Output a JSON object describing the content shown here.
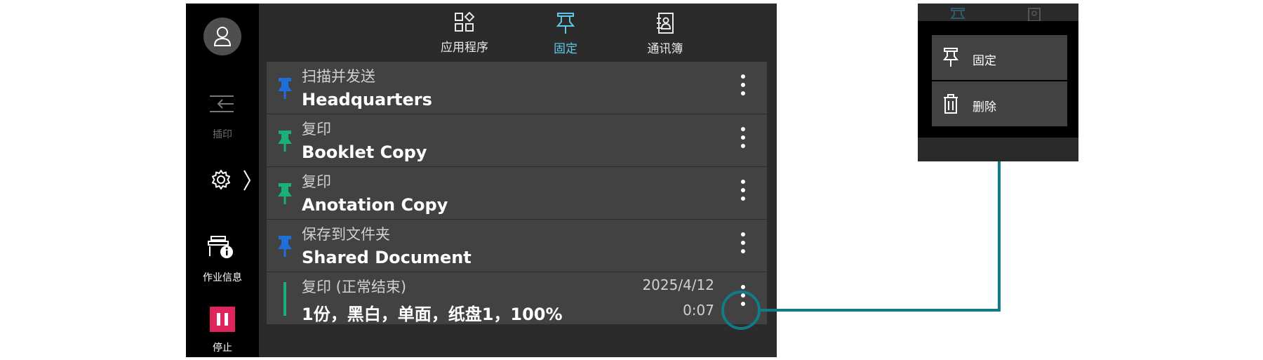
{
  "sidebar": {
    "insert_label": "插印",
    "job_info_label": "作业信息",
    "stop_label": "停止"
  },
  "tabs": [
    {
      "label": "应用程序",
      "icon": "apps-grid-icon"
    },
    {
      "label": "固定",
      "icon": "pin-icon",
      "active": true
    },
    {
      "label": "通讯簿",
      "icon": "address-book-icon"
    }
  ],
  "list": {
    "items": [
      {
        "category": "扫描并发送",
        "name": "Headquarters",
        "pin_color": "#1e6fd9"
      },
      {
        "category": "复印",
        "name": "Booklet Copy",
        "pin_color": "#1bb07a"
      },
      {
        "category": "复印",
        "name": "Anotation Copy",
        "pin_color": "#1bb07a"
      },
      {
        "category": "保存到文件夹",
        "name": "Shared Document",
        "pin_color": "#1e6fd9"
      }
    ],
    "history": {
      "category": "复印 (正常结束)",
      "detail": "1份，黑白，单面，纸盘1，100%",
      "date": "2025/4/12",
      "time": "0:07"
    }
  },
  "popup_menu": {
    "items": [
      {
        "label": "固定",
        "icon": "pin-icon"
      },
      {
        "label": "删除",
        "icon": "trash-icon"
      }
    ]
  },
  "colors": {
    "accent": "#5ec8e6",
    "callout": "#137b86",
    "stop": "#e0245c"
  }
}
